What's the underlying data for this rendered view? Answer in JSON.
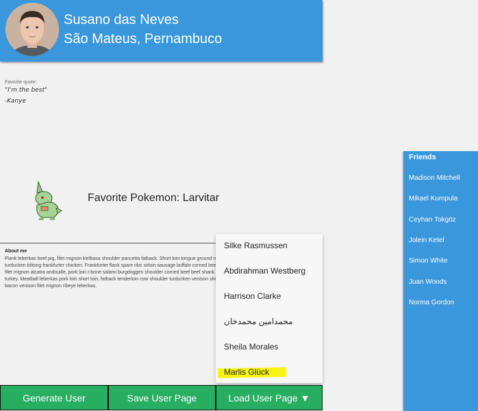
{
  "header": {
    "name": "Susano das Neves",
    "location": "São Mateus, Pernambuco"
  },
  "quote": {
    "label": "Favorite quote:",
    "text": "\"I'm the best\"",
    "author": "-Kanye"
  },
  "pokemon": {
    "label": "Favorite Pokemon: Larvitar"
  },
  "about": {
    "title": "About me",
    "lines": [
      "Flank leberkas beef pig, filet mignon kielbasa shoulder pancetta fatback. Short loin tongue ground round ball tip",
      "turducken biltong frankfurter chicken. Frankfurter flank spare ribs sirloin sausage buffalo corned beef ham",
      "filet mignon alcatra andouille, pork loin t-bone salami burgdoggen shoulder corned beef beef shank meatloaf",
      "turkey. Meatball leberkas pork loin short loin, fatback tenderloin cow shoulder turducken venison short ribs",
      "bacon venison filet mignon ribeye leberkas."
    ]
  },
  "friends": {
    "title": "Friends",
    "items": [
      "Madison Mitchell",
      "Mikael Kumpula",
      "Ceyhan Tokgöz",
      "Jolein Ketel",
      "Simon White",
      "Juan Woods",
      "Norma Gordon"
    ]
  },
  "dropdown": {
    "items": [
      "Silke Rasmussen",
      "Abdirahman Westberg",
      "Harrison Clarke",
      "محمدامین محمدخان",
      "Sheila Morales",
      "Marlis Glück"
    ],
    "highlight_color": "#f7f414"
  },
  "buttons": {
    "generate": "Generate User",
    "save": "Save User Page",
    "load": "Load User Page ▼"
  },
  "colors": {
    "accent": "#3a97dc",
    "button": "#27ae60",
    "background": "#f1f1f1"
  }
}
